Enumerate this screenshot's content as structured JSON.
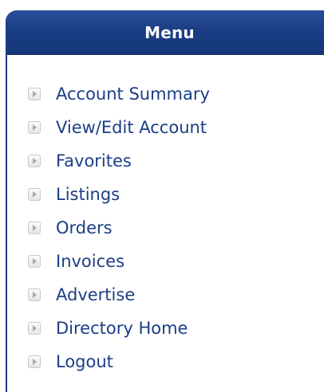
{
  "menu": {
    "title": "Menu",
    "accent_color": "#1b3e86",
    "bullet_icon": "arrow-right-icon",
    "items": [
      {
        "label": "Account Summary"
      },
      {
        "label": "View/Edit Account"
      },
      {
        "label": "Favorites"
      },
      {
        "label": "Listings"
      },
      {
        "label": "Orders"
      },
      {
        "label": "Invoices"
      },
      {
        "label": "Advertise"
      },
      {
        "label": "Directory Home"
      },
      {
        "label": "Logout"
      }
    ]
  }
}
